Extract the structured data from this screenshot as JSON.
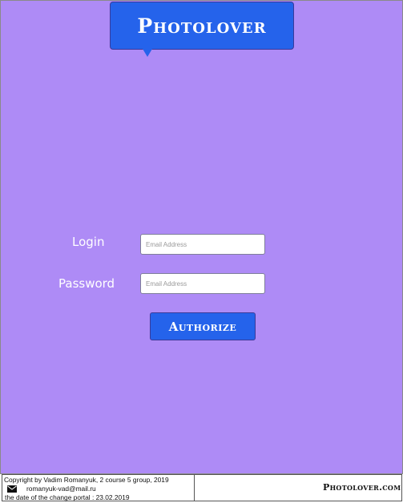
{
  "header": {
    "logo_text": "Photolover"
  },
  "form": {
    "login_label": "Login",
    "login_placeholder": "Email Address",
    "password_label": "Password",
    "password_placeholder": "Email Address",
    "authorize_label": "Authorize"
  },
  "footer": {
    "copyright": "Copyright by Vadim Romanyuk,   2 course   5 group, 2019",
    "email": "romanyuk-vad@mail.ru",
    "change_date": "the date of the change portal : 23.02.2019",
    "logo_text": "Photolover.com"
  },
  "colors": {
    "page_background": "#ae8bf6",
    "accent_blue": "#2563eb"
  },
  "icons": {
    "email": "envelope-icon"
  }
}
